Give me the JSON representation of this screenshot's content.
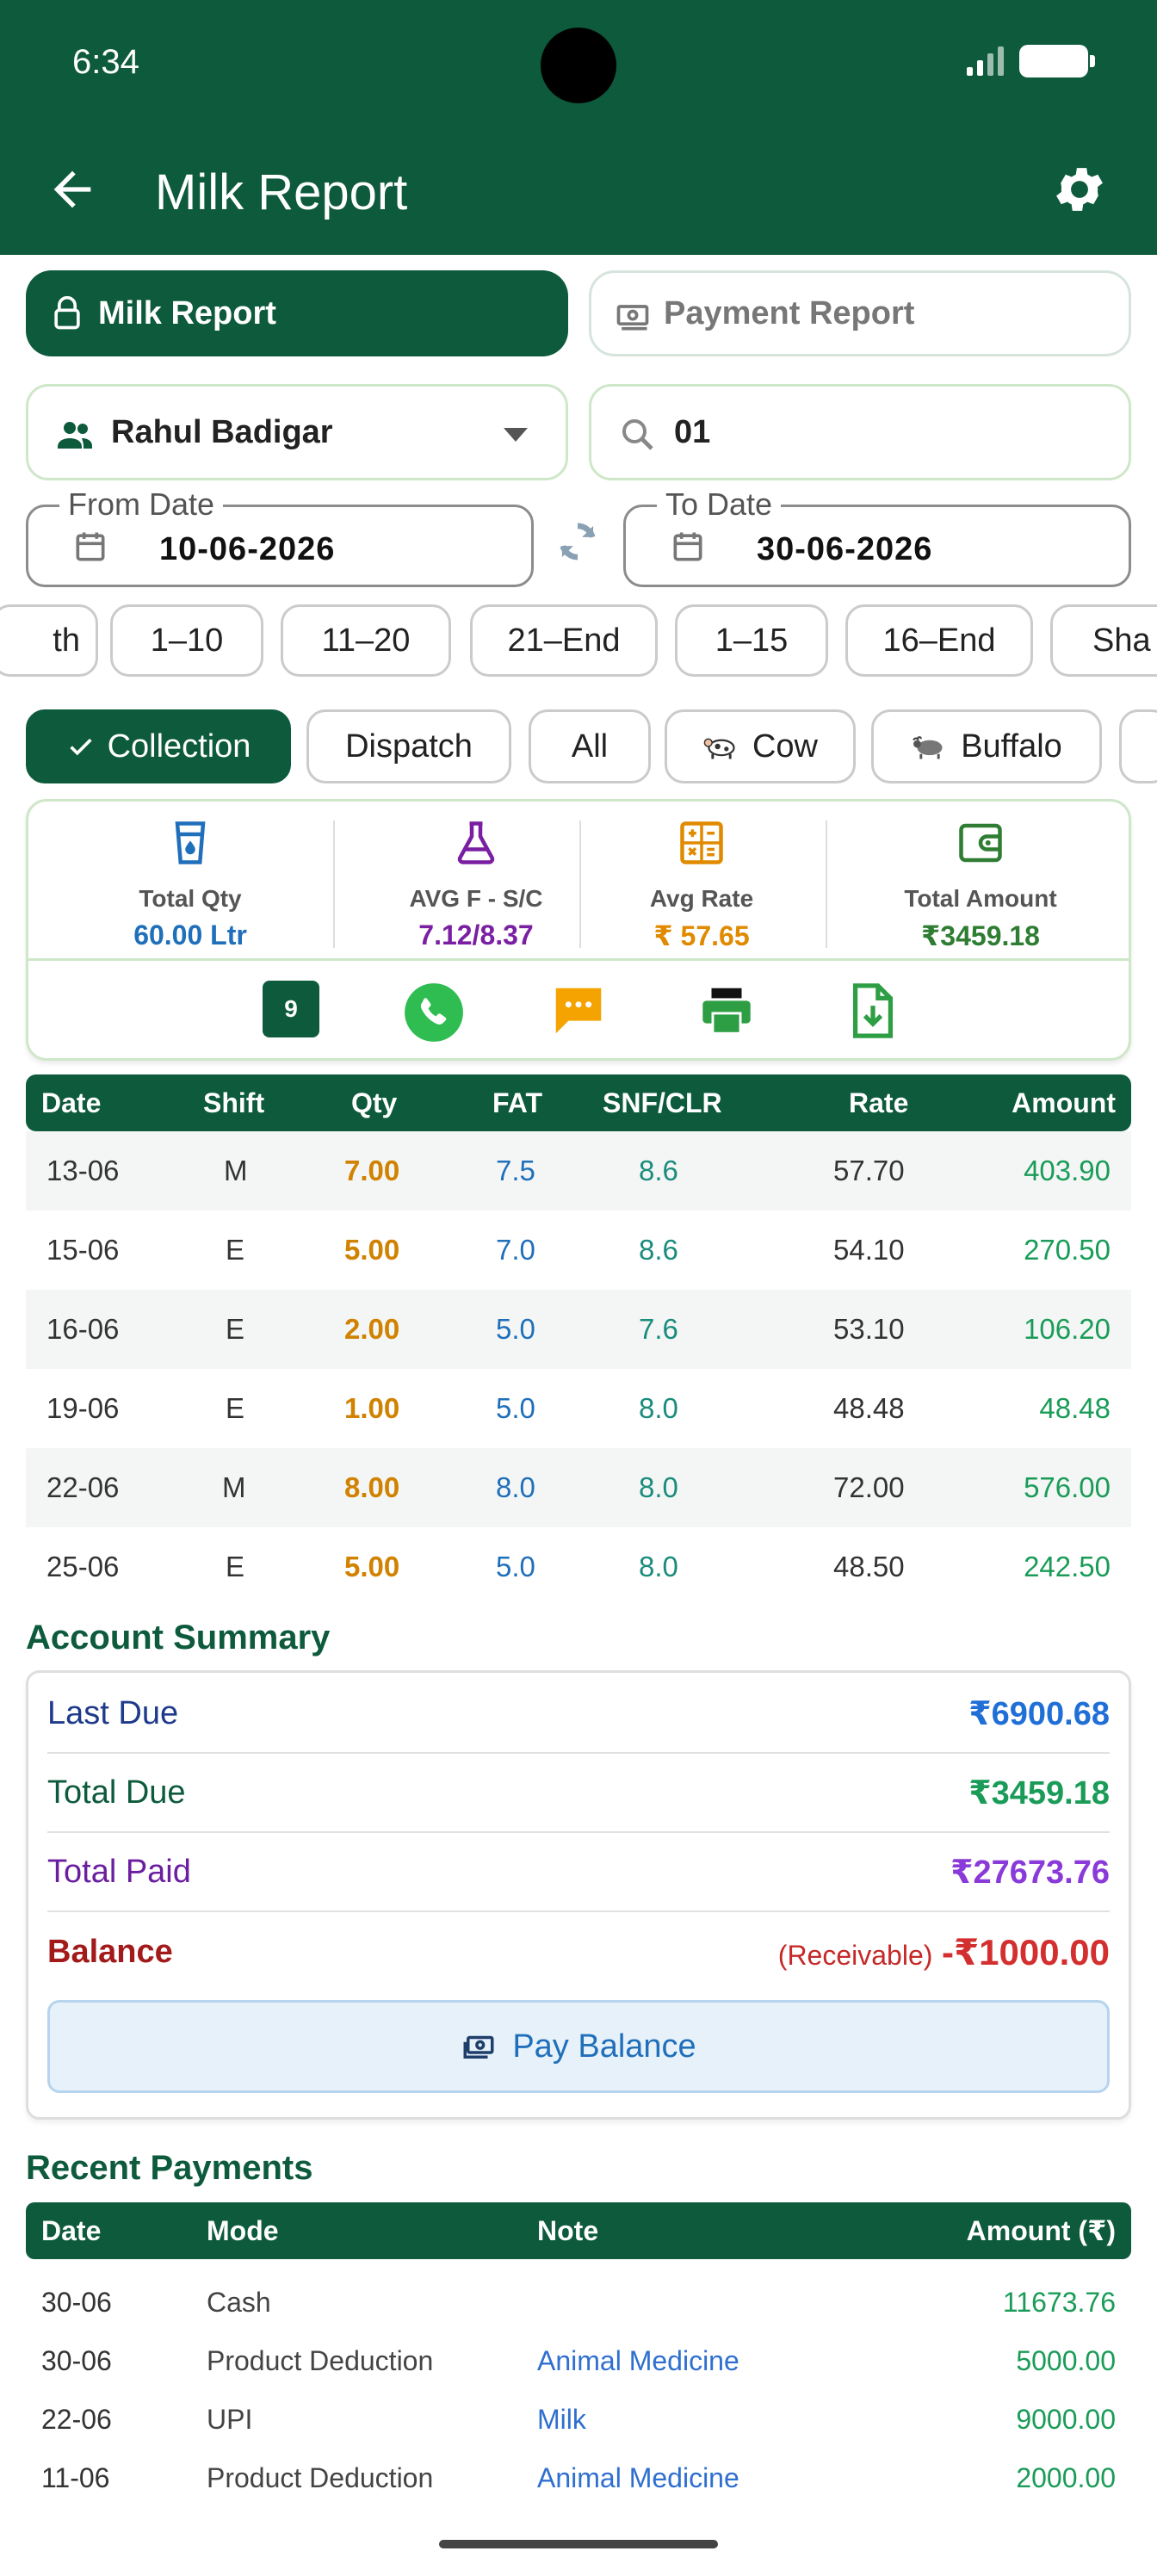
{
  "status_bar": {
    "time": "6:34"
  },
  "appbar": {
    "title": "Milk Report",
    "back_icon": "arrow-left-icon",
    "settings_icon": "gear-icon"
  },
  "report_tabs": [
    {
      "label": "Milk Report",
      "active": true,
      "icon": "lock-icon"
    },
    {
      "label": "Payment Report",
      "active": false,
      "icon": "cash-icon"
    }
  ],
  "customer_select": {
    "value": "Rahul Badigar",
    "icon": "people-icon"
  },
  "search": {
    "value": "01",
    "icon": "search-icon"
  },
  "from_date": {
    "label": "From Date",
    "value": "10-06-2026"
  },
  "to_date": {
    "label": "To Date",
    "value": "30-06-2026"
  },
  "range_chips": [
    "th",
    "1–10",
    "11–20",
    "21–End",
    "1–15",
    "16–End",
    "Sha"
  ],
  "type_chips": [
    {
      "label": "Collection",
      "active": true
    },
    {
      "label": "Dispatch"
    },
    {
      "label": "All"
    },
    {
      "label": "Cow"
    },
    {
      "label": "Buffalo"
    }
  ],
  "stats": {
    "total_qty": {
      "label": "Total Qty",
      "value": "60.00 Ltr",
      "color": "#1f6fba"
    },
    "avg_fat_snf": {
      "label": "AVG F - S/C",
      "value": "7.12/8.37",
      "color": "#7a1fa2"
    },
    "avg_rate": {
      "label": "Avg Rate",
      "value": "₹ 57.65",
      "color": "#e08a00"
    },
    "total_amount": {
      "label": "Total Amount",
      "value": "₹3459.18",
      "color": "#2e7d32"
    },
    "entry_count": "9"
  },
  "table": {
    "headers": [
      "Date",
      "Shift",
      "Qty",
      "FAT",
      "SNF/CLR",
      "Rate",
      "Amount"
    ],
    "rows": [
      [
        "13-06",
        "M",
        "7.00",
        "7.5",
        "8.6",
        "57.70",
        "403.90"
      ],
      [
        "15-06",
        "E",
        "5.00",
        "7.0",
        "8.6",
        "54.10",
        "270.50"
      ],
      [
        "16-06",
        "E",
        "2.00",
        "5.0",
        "7.6",
        "53.10",
        "106.20"
      ],
      [
        "19-06",
        "E",
        "1.00",
        "5.0",
        "8.0",
        "48.48",
        "48.48"
      ],
      [
        "22-06",
        "M",
        "8.00",
        "8.0",
        "8.0",
        "72.00",
        "576.00"
      ],
      [
        "25-06",
        "E",
        "5.00",
        "5.0",
        "8.0",
        "48.50",
        "242.50"
      ]
    ]
  },
  "account_summary": {
    "title": "Account Summary",
    "last_due": {
      "label": "Last Due",
      "value": "₹6900.68"
    },
    "total_due": {
      "label": "Total Due",
      "value": "₹3459.18"
    },
    "total_paid": {
      "label": "Total Paid",
      "value": "₹27673.76"
    },
    "balance": {
      "label": "Balance",
      "note": "(Receivable)",
      "value": "-₹1000.00"
    },
    "pay_button": "Pay Balance"
  },
  "recent_payments": {
    "title": "Recent Payments",
    "headers": [
      "Date",
      "Mode",
      "Note",
      "Amount (₹)"
    ],
    "rows": [
      [
        "30-06",
        "Cash",
        "",
        "11673.76"
      ],
      [
        "30-06",
        "Product Deduction",
        "Animal Medicine",
        "5000.00"
      ],
      [
        "22-06",
        "UPI",
        "Milk",
        "9000.00"
      ],
      [
        "11-06",
        "Product Deduction",
        "Animal Medicine",
        "2000.00"
      ]
    ]
  }
}
